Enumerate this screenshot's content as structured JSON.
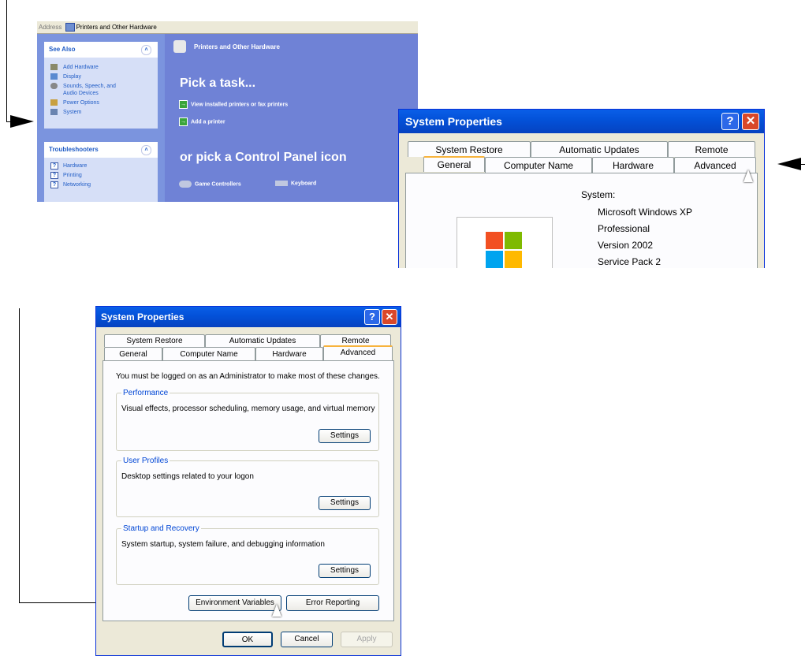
{
  "control_panel": {
    "address_label": "Address",
    "address_value": "Printers and Other Hardware",
    "see_also": {
      "title": "See Also",
      "items": [
        "Add Hardware",
        "Display",
        "Sounds, Speech, and",
        "Audio Devices",
        "Power Options",
        "System"
      ]
    },
    "troubleshooters": {
      "title": "Troubleshooters",
      "items": [
        "Hardware",
        "Printing",
        "Networking"
      ]
    },
    "header_title": "Printers and Other Hardware",
    "pick_task": "Pick a task...",
    "tasks": [
      "View installed printers or fax printers",
      "Add a printer"
    ],
    "pick_icon": "or pick a Control Panel icon",
    "icons": [
      "Game Controllers",
      "Keyboard"
    ]
  },
  "sys_props_top": {
    "title": "System Properties",
    "help_glyph": "?",
    "close_glyph": "✕",
    "tabs_row1": [
      "System Restore",
      "Automatic Updates",
      "Remote"
    ],
    "tabs_row2": [
      "General",
      "Computer Name",
      "Hardware",
      "Advanced"
    ],
    "system_label": "System:",
    "system_lines": [
      "Microsoft Windows XP",
      "Professional",
      "Version 2002",
      "Service Pack 2"
    ]
  },
  "sys_props_bottom": {
    "title": "System Properties",
    "help_glyph": "?",
    "close_glyph": "✕",
    "tabs_row1": [
      "System Restore",
      "Automatic Updates",
      "Remote"
    ],
    "tabs_row2": [
      "General",
      "Computer Name",
      "Hardware",
      "Advanced"
    ],
    "admin_note": "You must be logged on as an Administrator to make most of these changes.",
    "performance": {
      "label": "Performance",
      "desc": "Visual effects, processor scheduling, memory usage, and virtual memory",
      "button": "Settings"
    },
    "user_profiles": {
      "label": "User Profiles",
      "desc": "Desktop settings related to your logon",
      "button": "Settings"
    },
    "startup": {
      "label": "Startup and Recovery",
      "desc": "System startup, system failure, and debugging information",
      "button": "Settings"
    },
    "env_button": "Environment Variables",
    "error_button": "Error Reporting",
    "ok": "OK",
    "cancel": "Cancel",
    "apply": "Apply"
  }
}
